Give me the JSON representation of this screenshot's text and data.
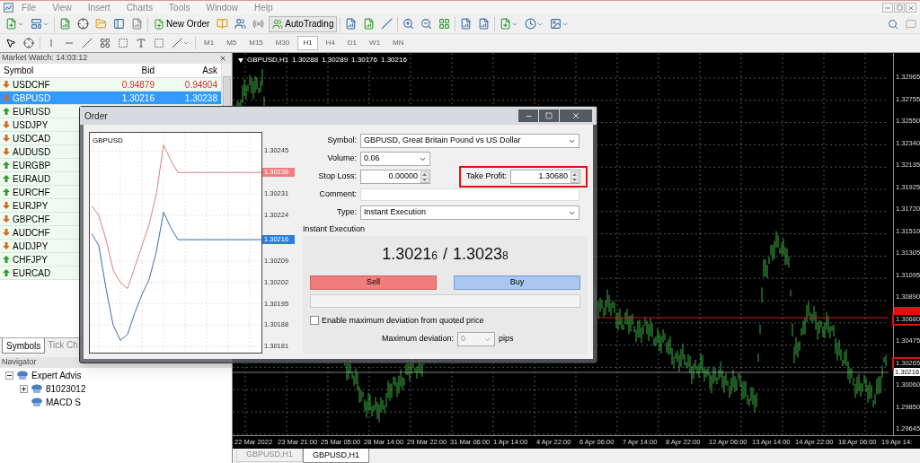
{
  "menu": [
    {
      "label": "File"
    },
    {
      "label": "View"
    },
    {
      "label": "Insert"
    },
    {
      "label": "Charts"
    },
    {
      "label": "Tools"
    },
    {
      "label": "Window"
    },
    {
      "label": "Help"
    }
  ],
  "toolbar": {
    "new_order": "New Order",
    "auto_trading": "AutoTrading"
  },
  "timeframes": [
    {
      "label": "M1",
      "selected": false
    },
    {
      "label": "M5",
      "selected": false
    },
    {
      "label": "M15",
      "selected": false
    },
    {
      "label": "M30",
      "selected": false
    },
    {
      "label": "H1",
      "selected": true
    },
    {
      "label": "H4",
      "selected": false
    },
    {
      "label": "D1",
      "selected": false
    },
    {
      "label": "W1",
      "selected": false
    },
    {
      "label": "MN",
      "selected": false
    }
  ],
  "market_watch": {
    "title": "Market Watch: 14:03:12",
    "columns": [
      "Symbol",
      "Bid",
      "Ask"
    ],
    "rows": [
      {
        "symbol": "USDCHF",
        "bid": "0.94879",
        "ask": "0.94904",
        "kind": "down",
        "selected": false
      },
      {
        "symbol": "GBPUSD",
        "bid": "1.30216",
        "ask": "1.30238",
        "kind": "down",
        "selected": true
      },
      {
        "symbol": "EURUSD",
        "kind": "up",
        "selected": false
      },
      {
        "symbol": "USDJPY",
        "kind": "down",
        "selected": false
      },
      {
        "symbol": "USDCAD",
        "kind": "down",
        "selected": false
      },
      {
        "symbol": "AUDUSD",
        "kind": "down",
        "selected": false
      },
      {
        "symbol": "EURGBP",
        "kind": "up",
        "selected": false
      },
      {
        "symbol": "EURAUD",
        "kind": "up",
        "selected": false
      },
      {
        "symbol": "EURCHF",
        "kind": "up",
        "selected": false
      },
      {
        "symbol": "EURJPY",
        "kind": "down",
        "selected": false
      },
      {
        "symbol": "GBPCHF",
        "kind": "down",
        "selected": false
      },
      {
        "symbol": "AUDCHF",
        "kind": "down",
        "selected": false
      },
      {
        "symbol": "AUDJPY",
        "kind": "down",
        "selected": false
      },
      {
        "symbol": "CHFJPY",
        "kind": "up",
        "selected": false
      },
      {
        "symbol": "EURCAD",
        "kind": "up",
        "selected": false
      }
    ],
    "tabs": [
      {
        "label": "Symbols",
        "selected": true
      },
      {
        "label": "Tick Ch",
        "selected": false
      }
    ]
  },
  "navigator": {
    "title": "Navigator",
    "tree": [
      {
        "label": "Expert Advis",
        "expanded": true,
        "children": [
          {
            "label": "81023012",
            "expanded": false
          },
          {
            "label": "MACD S"
          }
        ]
      }
    ]
  },
  "chart": {
    "symbol": "GBPUSD,H1",
    "quotes": [
      "1.30288",
      "1.30289",
      "1.30176",
      "1.30216"
    ],
    "price_axis": [
      {
        "text": "1.32965"
      },
      {
        "text": "1.32755"
      },
      {
        "text": "1.32550"
      },
      {
        "text": "1.32340"
      },
      {
        "text": "1.32135"
      },
      {
        "text": "1.31925"
      },
      {
        "text": "1.31720"
      },
      {
        "text": "1.31510"
      },
      {
        "text": "1.31305"
      },
      {
        "text": "1.31095"
      },
      {
        "text": "1.30890"
      },
      {
        "text": "1.30680",
        "highlighted": true,
        "tag": {
          "kind": "take-profit"
        }
      },
      {
        "text": "1.30475"
      },
      {
        "text": "1.30265",
        "highlighted": true,
        "tag": {
          "kind": "bid",
          "text": "1.30216"
        }
      },
      {
        "text": "1.30060"
      },
      {
        "text": "1.29850"
      },
      {
        "text": "1.29645"
      }
    ],
    "time_axis": [
      "22 Mar 2022",
      "23 Mar 21:00",
      "25 Mar 05:00",
      "28 Mar 14:00",
      "29 Mar 22:00",
      "31 Mar 06:00",
      "1 Apr 14:00",
      "4 Apr 22:00",
      "6 Apr 06:00",
      "7 Apr 14:00",
      "8 Apr 22:00",
      "12 Apr 06:00",
      "13 Apr 14:00",
      "14 Apr 22:00",
      "18 Apr 06:00",
      "19 Apr 14:"
    ]
  },
  "chart_tabs": [
    {
      "label": "GBPUSD,H1",
      "selected": false
    },
    {
      "label": "GBPUSD,H1",
      "selected": true
    }
  ],
  "order": {
    "title": "Order",
    "mini_chart": {
      "price_tags": [
        {
          "text": "1.30238",
          "kind": "ask"
        },
        {
          "text": "1.30216",
          "kind": "bid"
        }
      ],
      "chart_data": {
        "type": "line",
        "title": "GBPUSD",
        "grid": true,
        "ylim": [
          1.30179,
          1.30251
        ],
        "yticks": [
          1.30245,
          1.30231,
          1.30224,
          1.30209,
          1.30202,
          1.30195,
          1.30188,
          1.30181
        ],
        "series": [
          {
            "color": "#d98080",
            "values": [
              1.30227,
              1.30224,
              1.30216,
              1.30206,
              1.30202,
              1.302,
              1.30207,
              1.30214,
              1.30221,
              1.30231,
              1.30247,
              1.30242,
              1.30238,
              1.30238,
              1.30238,
              1.30238,
              1.30238,
              1.30238,
              1.30238,
              1.30238,
              1.30238,
              1.30238,
              1.30238,
              1.30238
            ]
          },
          {
            "color": "#3a6fa8",
            "values": [
              1.30218,
              1.30214,
              1.302,
              1.30188,
              1.30183,
              1.30185,
              1.30192,
              1.30198,
              1.30203,
              1.30212,
              1.30225,
              1.3022,
              1.30216,
              1.30216,
              1.30216,
              1.30216,
              1.30216,
              1.30216,
              1.30216,
              1.30216,
              1.30216,
              1.30216,
              1.30216,
              1.30216
            ]
          }
        ]
      }
    },
    "symbol": {
      "label": "Symbol:",
      "value": "GBPUSD, Great Britain Pound vs US Dollar"
    },
    "volume": {
      "label": "Volume:",
      "value": "0.06"
    },
    "stop_loss": {
      "label": "Stop Loss:",
      "value": "0.00000"
    },
    "take_profit": {
      "label": "Take Profit:",
      "value": "1.30680",
      "highlighted": true
    },
    "comment": {
      "label": "Comment:"
    },
    "type": {
      "label": "Type:",
      "value": "Instant Execution"
    },
    "section": "Instant Execution",
    "quote": {
      "bid": "1.3021",
      "bid_pip": "6",
      "separator": "/",
      "ask": "1.3023",
      "ask_pip": "8"
    },
    "sell": "Sell",
    "buy": "Buy",
    "deviation_check": {
      "label": "Enable maximum deviation from quoted price",
      "checked": false
    },
    "deviation": {
      "label": "Maximum deviation:",
      "value": "0",
      "unit": "pips",
      "disabled": true
    }
  }
}
